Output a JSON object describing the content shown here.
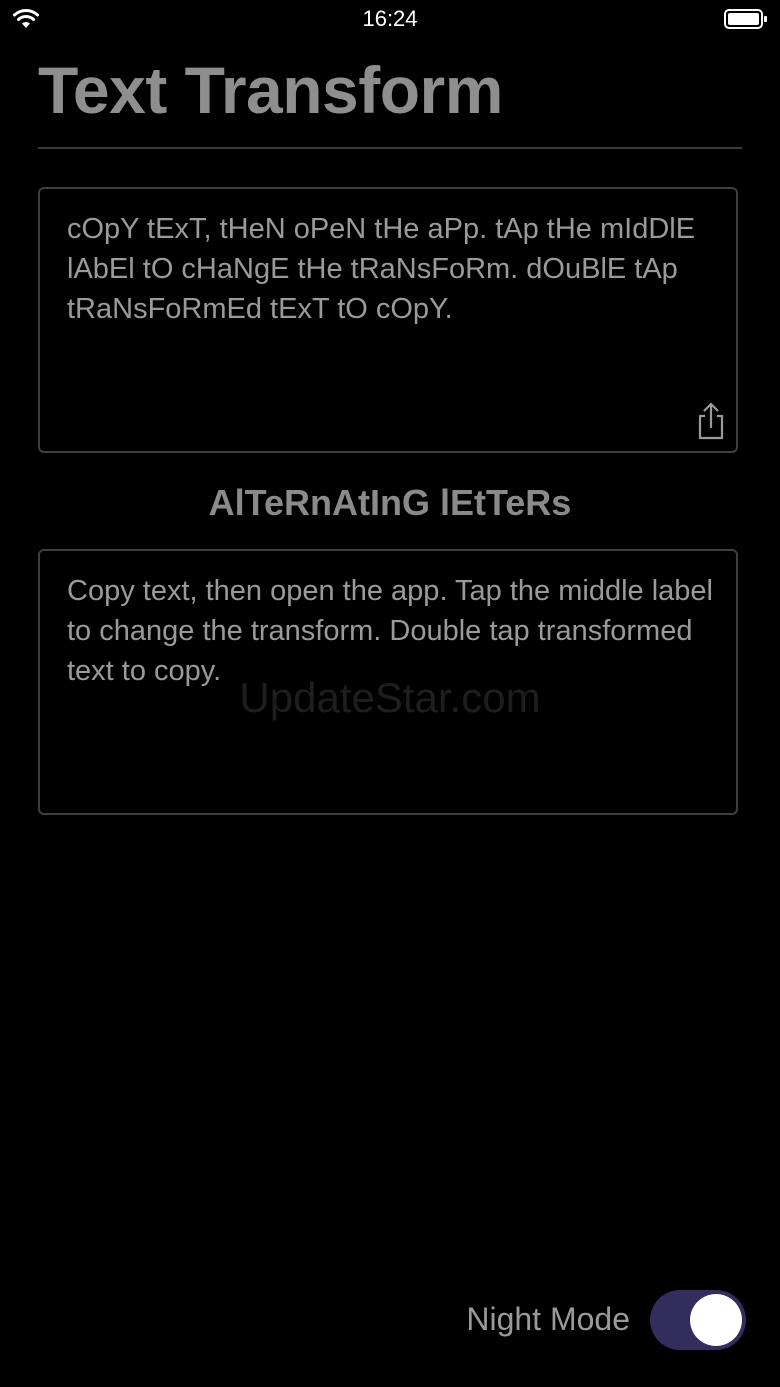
{
  "status_bar": {
    "time": "16:24",
    "wifi_icon": "wifi-icon",
    "battery_icon": "battery-icon"
  },
  "header": {
    "title": "Text Transform"
  },
  "input_box": {
    "text": "cOpY tExT, tHeN oPeN tHe aPp. tAp tHe mIdDlE lAbEl tO cHaNgE tHe tRaNsFoRm. dOuBlE tAp tRaNsFoRmEd tExT tO cOpY.",
    "share_icon": "share-icon"
  },
  "transform": {
    "label": "AlTeRnAtInG lEtTeRs"
  },
  "output_box": {
    "text": "Copy text, then open the app. Tap the middle label to change the transform. Double tap transformed text to copy."
  },
  "watermark": {
    "text": "UpdateStar.com"
  },
  "footer": {
    "night_mode_label": "Night Mode",
    "night_mode_on": true
  },
  "colors": {
    "background": "#000000",
    "toggle_track": "#322d5c",
    "toggle_knob": "#ffffff",
    "text_gray": "#9a9a9a",
    "border_gray": "#3f3f3f"
  }
}
